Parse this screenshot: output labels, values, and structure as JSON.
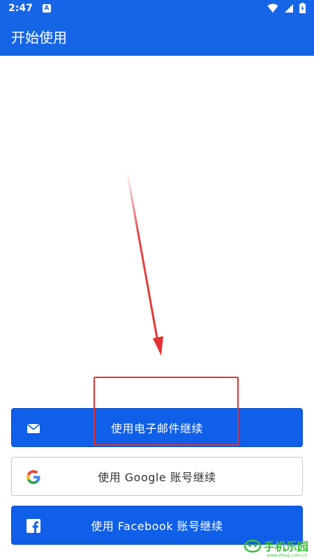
{
  "status_bar": {
    "time": "2:47",
    "notification_badge": "A"
  },
  "app_bar": {
    "title": "开始使用"
  },
  "buttons": {
    "email_label": "使用电子邮件继续",
    "google_label": "使用 Google 账号继续",
    "facebook_label": "使用 Facebook 账号继续"
  },
  "icons": {
    "email": "mail-icon",
    "google": "google-logo-icon",
    "facebook": "facebook-logo-icon"
  },
  "watermark": {
    "brand": "手机乐园",
    "url": "www.shouji.com.cn"
  },
  "colors": {
    "primary": "#1565e6",
    "button_blue": "#0f5fe8",
    "annotation_red": "#e53030",
    "watermark_green": "#3cbf3c"
  }
}
